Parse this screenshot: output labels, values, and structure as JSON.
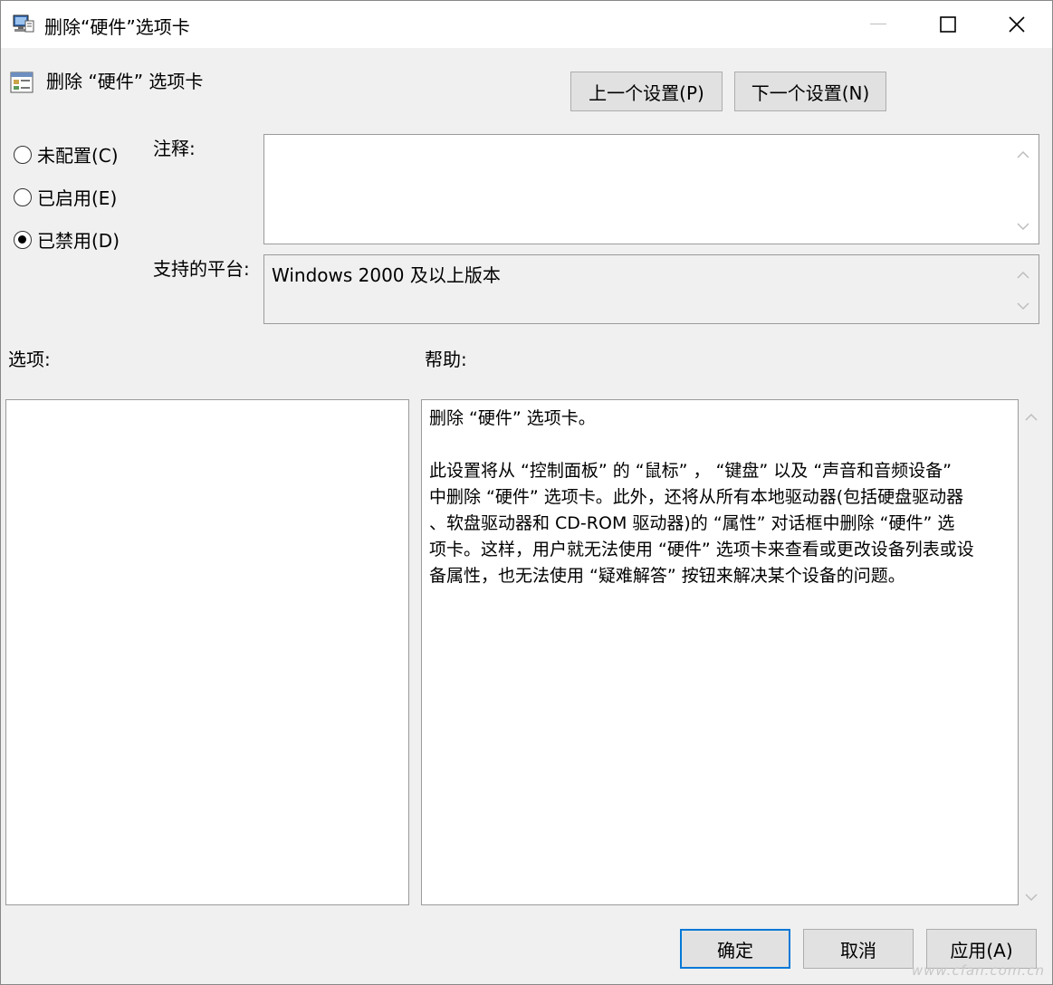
{
  "window": {
    "title": "删除“硬件”选项卡"
  },
  "header": {
    "title": "删除 “硬件” 选项卡",
    "prev_button": "上一个设置(P)",
    "next_button": "下一个设置(N)"
  },
  "state": {
    "options": [
      {
        "label": "未配置(C)",
        "checked": false
      },
      {
        "label": "已启用(E)",
        "checked": false
      },
      {
        "label": "已禁用(D)",
        "checked": true
      }
    ]
  },
  "comment": {
    "label": "注释:",
    "value": ""
  },
  "platform": {
    "label": "支持的平台:",
    "value": "Windows 2000 及以上版本"
  },
  "sections": {
    "options_label": "选项:",
    "help_label": "帮助:"
  },
  "help": {
    "text": "删除 “硬件” 选项卡。\n\n此设置将从 “控制面板” 的 “鼠标” ， “键盘” 以及 “声音和音频设备”\n中删除 “硬件” 选项卡。此外，还将从所有本地驱动器(包括硬盘驱动器\n、软盘驱动器和 CD-ROM 驱动器)的 “属性” 对话框中删除 “硬件” 选\n项卡。这样，用户就无法使用 “硬件” 选项卡来查看或更改设备列表或设\n备属性，也无法使用 “疑难解答” 按钮来解决某个设备的问题。"
  },
  "footer": {
    "ok": "确定",
    "cancel": "取消",
    "apply": "应用(A)"
  },
  "watermark": "www.cfan.com.cn",
  "icons": {
    "title": "policy-computer-icon",
    "header": "policy-setting-icon",
    "minimize": "minimize-icon",
    "maximize": "maximize-icon",
    "close": "close-icon"
  }
}
